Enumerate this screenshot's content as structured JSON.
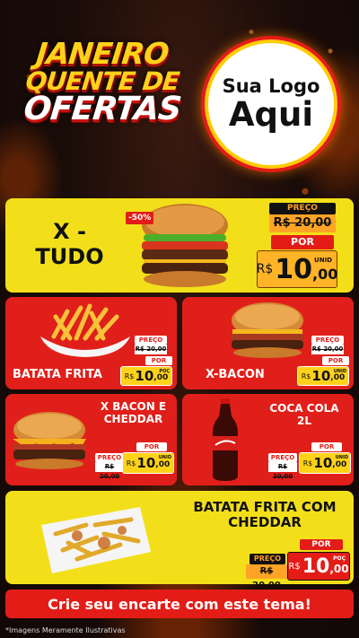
{
  "header": {
    "title_line1": "JANEIRO",
    "title_line2": "QUENTE DE",
    "title_line3": "OFERTAS",
    "logo_line1": "Sua Logo",
    "logo_line2": "Aqui"
  },
  "products": [
    {
      "name": "X - TUDO",
      "discount": "-50%",
      "preco_label": "PREÇO",
      "old_price": "R$ 20,00",
      "por_label": "POR",
      "currency": "R$",
      "price_int": "10",
      "price_dec": ",00",
      "unit": "UNID"
    },
    {
      "name": "BATATA FRITA",
      "preco_label": "PREÇO",
      "old_price": "R$ 20,00",
      "por_label": "POR",
      "currency": "R$",
      "price_int": "10",
      "price_dec": ",00",
      "unit": "POÇ"
    },
    {
      "name": "X-BACON",
      "preco_label": "PREÇO",
      "old_price": "R$ 20,00",
      "por_label": "POR",
      "currency": "R$",
      "price_int": "10",
      "price_dec": ",00",
      "unit": "UNID"
    },
    {
      "name": "X BACON E CHEDDAR",
      "preco_label": "PREÇO",
      "old_price": "R$ 20,00",
      "por_label": "POR",
      "currency": "R$",
      "price_int": "10",
      "price_dec": ",00",
      "unit": "UNID"
    },
    {
      "name": "COCA COLA 2L",
      "preco_label": "PREÇO",
      "old_price": "R$ 20,00",
      "por_label": "POR",
      "currency": "R$",
      "price_int": "10",
      "price_dec": ",00",
      "unit": "UNID"
    },
    {
      "name": "BATATA FRITA COM CHEDDAR",
      "preco_label": "PREÇO",
      "old_price": "R$ 20,00",
      "por_label": "POR",
      "currency": "R$",
      "price_int": "10",
      "price_dec": ",00",
      "unit": "POÇ"
    }
  ],
  "footer": {
    "cta": "Crie seu encarte com este tema!",
    "disclaimer": "*Imagens Meramente Ilustrativas"
  },
  "colors": {
    "red": "#e11f1a",
    "yellow": "#f2df19",
    "orange": "#ffb326",
    "dark_bg": "#1a0c08"
  }
}
